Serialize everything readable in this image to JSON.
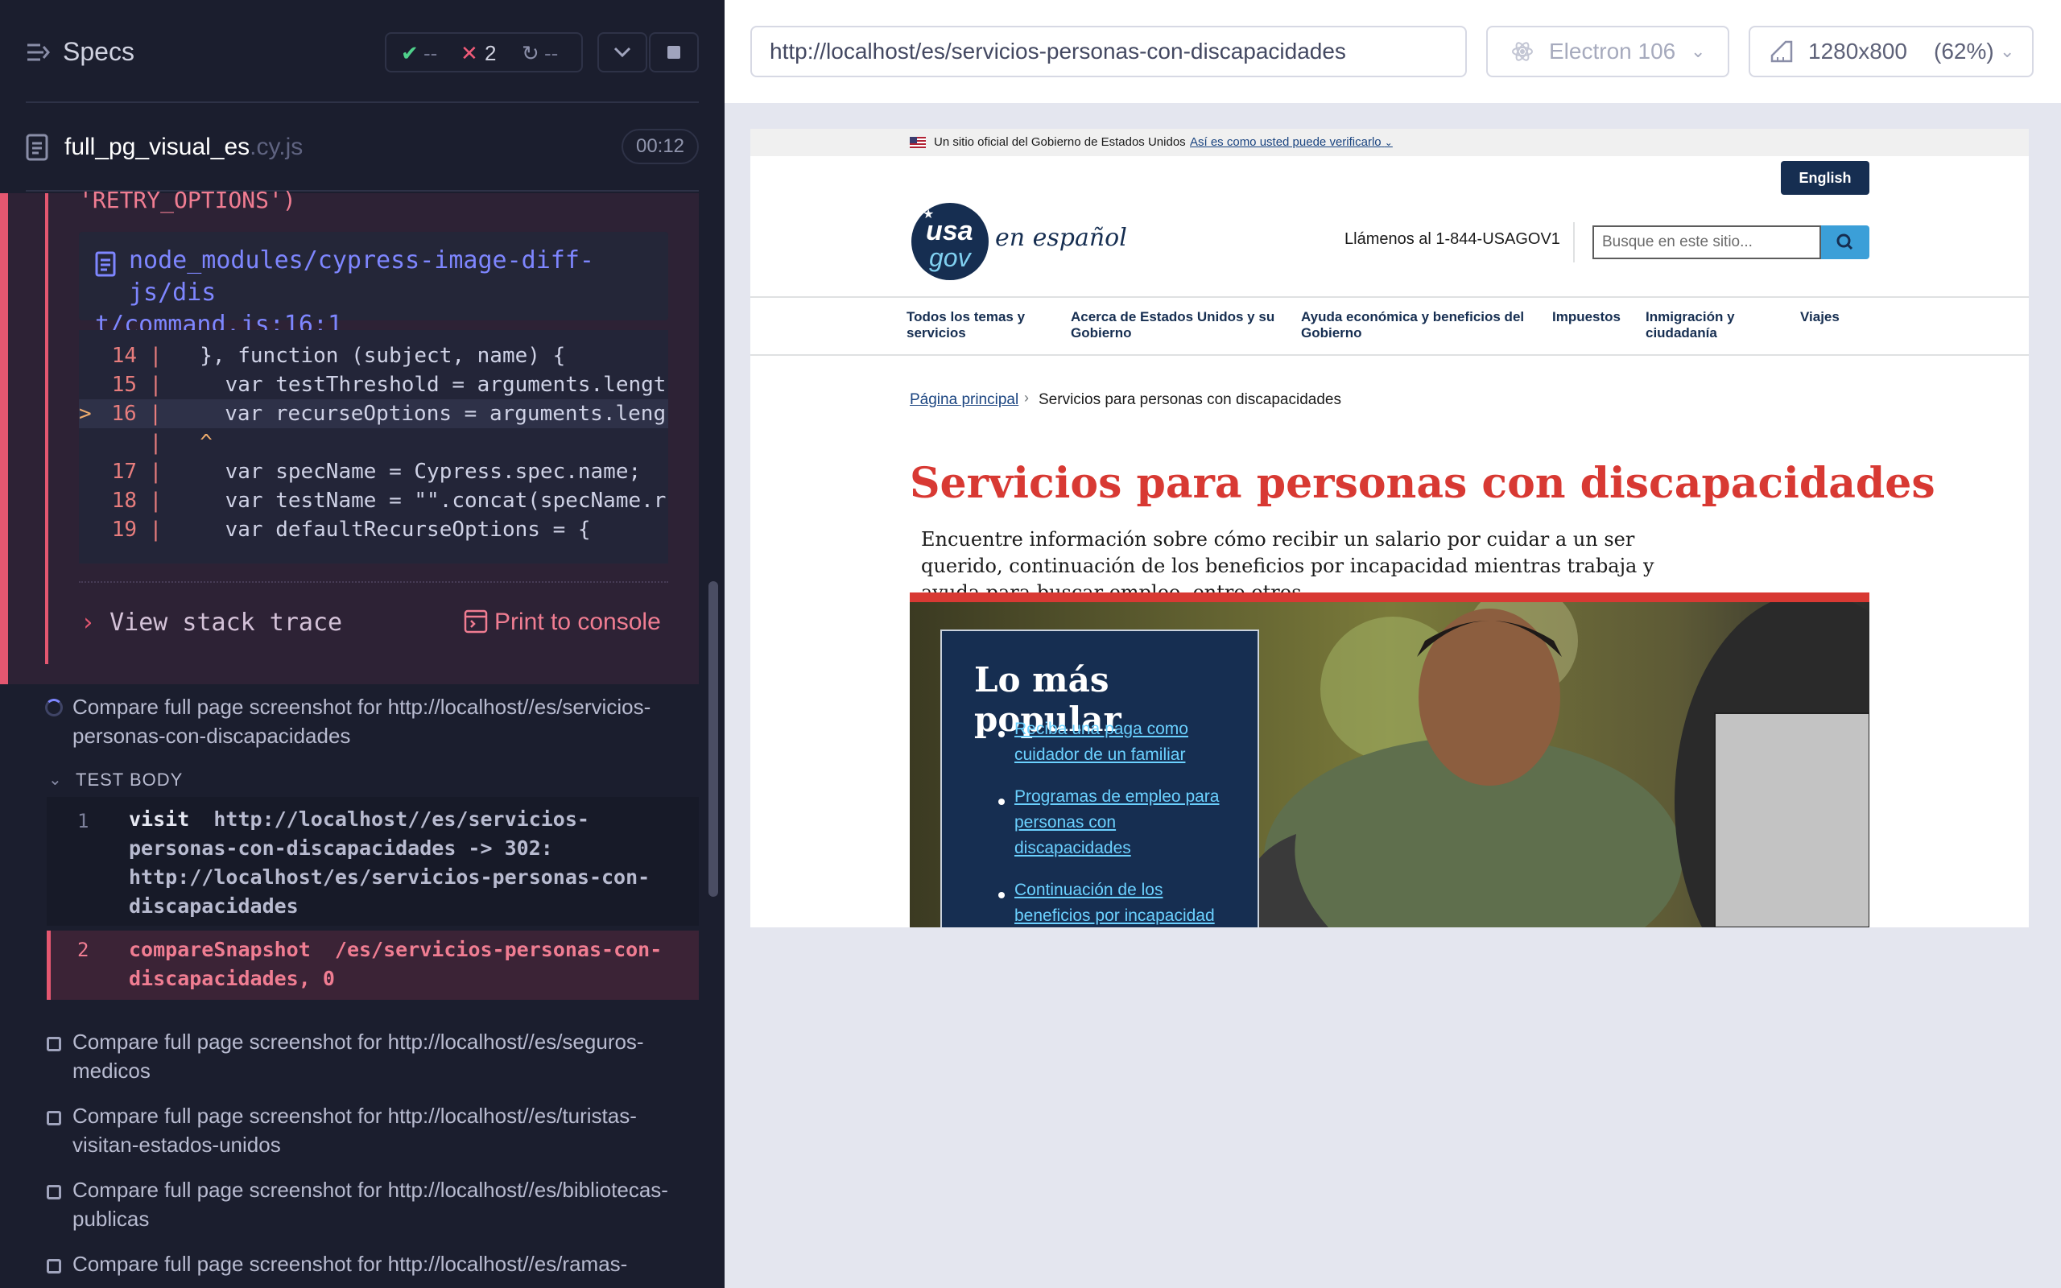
{
  "runner": {
    "specs_label": "Specs",
    "stats": {
      "passed": "--",
      "failed": "2",
      "pending": "--"
    },
    "spec_file": {
      "name": "full_pg_visual_es",
      "ext": ".cy.js",
      "duration": "00:12"
    },
    "error": {
      "message_tail": "'RETRY_OPTIONS')",
      "file_path": "node_modules/cypress-image-diff-js/dist/command.js:16:1",
      "file_path_line1": "node_modules/cypress-image-diff-js/dis",
      "file_path_line2": "t/command.js:16:1",
      "code_lines": [
        {
          "num": "14",
          "marker": " ",
          "text": "  }, function (subject, name) {"
        },
        {
          "num": "15",
          "marker": " ",
          "text": "    var testThreshold = arguments.lengt"
        },
        {
          "num": "16",
          "marker": ">",
          "text": "    var recurseOptions = arguments.leng"
        },
        {
          "num": "",
          "marker": " ",
          "text": "  ^"
        },
        {
          "num": "17",
          "marker": " ",
          "text": "    var specName = Cypress.spec.name;"
        },
        {
          "num": "18",
          "marker": " ",
          "text": "    var testName = \"\".concat(specName.r"
        },
        {
          "num": "19",
          "marker": " ",
          "text": "    var defaultRecurseOptions = {"
        }
      ],
      "view_stack_trace": "View stack trace",
      "print_to_console": "Print to console"
    },
    "current_test": "Compare full page screenshot for http://localhost//es/servicios-personas-con-discapacidades",
    "test_body_label": "TEST BODY",
    "commands": [
      {
        "num": "1",
        "name": "visit",
        "message": "http://localhost//es/servicios-personas-con-discapacidades -> 302: http://localhost/es/servicios-personas-con-discapacidades"
      },
      {
        "num": "2",
        "name": "compareSnapshot",
        "message": "/es/servicios-personas-con-discapacidades, 0"
      }
    ],
    "pending_tests": [
      "Compare full page screenshot for http://localhost//es/seguros-medicos",
      "Compare full page screenshot for http://localhost//es/turistas-visitan-estados-unidos",
      "Compare full page screenshot for http://localhost//es/bibliotecas-publicas",
      "Compare full page screenshot for http://localhost//es/ramas-"
    ]
  },
  "browser_bar": {
    "url": "http://localhost/es/servicios-personas-con-discapacidades",
    "browser": "Electron 106",
    "viewport": "1280x800",
    "viewport_scale": "(62%)"
  },
  "site": {
    "gov_banner": "Un sitio oficial del Gobierno de Estados Unidos",
    "gov_banner_link": "Así es como usted puede verificarlo",
    "language_button": "English",
    "logo_usa": "usa",
    "logo_gov": "gov",
    "logo_tagline": "en español",
    "phone": "Llámenos al 1-844-USAGOV1",
    "search_placeholder": "Busque en este sitio...",
    "nav": [
      {
        "l1": "Todos los temas y",
        "l2": "servicios"
      },
      {
        "l1": "Acerca de Estados Unidos y su",
        "l2": "Gobierno"
      },
      {
        "l1": "Ayuda económica y beneficios del",
        "l2": "Gobierno"
      },
      {
        "l1": "Impuestos",
        "l2": ""
      },
      {
        "l1": "Inmigración y",
        "l2": "ciudadanía"
      },
      {
        "l1": "Viajes",
        "l2": ""
      }
    ],
    "breadcrumb_home": "Página principal",
    "breadcrumb_current": "Servicios para personas con discapacidades",
    "title": "Servicios para personas con discapacidades",
    "intro": "Encuentre información sobre cómo recibir un salario por cuidar a un ser querido, continuación de los beneficios por incapacidad mientras trabaja y ayuda para buscar empleo, entre otros.",
    "popular_title": "Lo más popular",
    "popular_links": [
      {
        "l1": "Reciba una paga como",
        "l2": "cuidador de un familiar",
        "l3": ""
      },
      {
        "l1": "Programas de empleo para",
        "l2": "personas con",
        "l3": "discapacidades"
      },
      {
        "l1": "Continuación de los",
        "l2": "beneficios por incapacidad",
        "l3": ""
      }
    ]
  },
  "colors": {
    "runner_bg": "#1b1e2e",
    "error_red": "#e45770",
    "usagov_navy": "#162e51",
    "usagov_red": "#d83933"
  }
}
